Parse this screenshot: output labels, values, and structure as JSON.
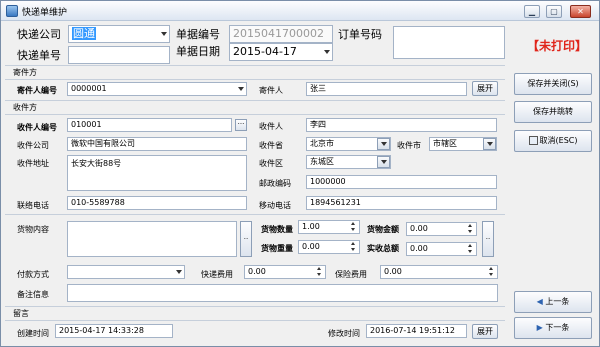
{
  "window": {
    "title": "快递单维护",
    "controls": {
      "minimize": "▁",
      "maximize": "▢",
      "close": "✕"
    }
  },
  "header": {
    "courier_company_label": "快递公司",
    "courier_company_value": "圆通",
    "doc_no_label": "单据编号",
    "doc_no_value": "2015041700002",
    "order_no_label": "订单号码",
    "order_no_value": "",
    "waybill_no_label": "快递单号",
    "waybill_no_value": "",
    "doc_date_label": "单据日期",
    "doc_date_value": "2015-04-17",
    "print_status": "【未打印】"
  },
  "sender": {
    "section_label": "寄件方",
    "sender_no_label": "寄件人编号",
    "sender_no_value": "0000001",
    "sender_label": "寄件人",
    "sender_value": "张三",
    "expand_label": "展开"
  },
  "receiver": {
    "section_label": "收件方",
    "receiver_no_label": "收件人编号",
    "receiver_no_value": "010001",
    "receiver_label": "收件人",
    "receiver_value": "李四",
    "company_label": "收件公司",
    "company_value": "微软中国有限公司",
    "province_label": "收件省",
    "province_value": "北京市",
    "city_label": "收件市",
    "city_value": "市辖区",
    "address_label": "收件地址",
    "address_value": "长安大街88号",
    "district_label": "收件区",
    "district_value": "东城区",
    "postcode_label": "邮政编码",
    "postcode_value": "1000000",
    "phone_label": "联络电话",
    "phone_value": "010-5589788",
    "mobile_label": "移动电话",
    "mobile_value": "1894561231"
  },
  "goods": {
    "content_label": "货物内容",
    "content_value": "",
    "qty_label": "货物数量",
    "qty_value": "1.00",
    "amount_label": "货物金额",
    "amount_value": "0.00",
    "weight_label": "货物重量",
    "weight_value": "0.00",
    "actual_total_label": "实收总额",
    "actual_total_value": "0.00",
    "payment_label": "付款方式",
    "payment_value": "",
    "fee_label": "快递费用",
    "fee_value": "0.00",
    "insurance_label": "保险费用",
    "insurance_value": "0.00",
    "remark_label": "备注信息",
    "remark_value": ""
  },
  "message": {
    "section_label": "留言",
    "created_label": "创建时间",
    "created_value": "2015-04-17 14:33:28",
    "modified_label": "修改时间",
    "modified_value": "2016-07-14 19:51:12",
    "expand_label": "展开"
  },
  "sidebar": {
    "save_close": "保存并关闭(S)",
    "save_jump": "保存并跳转",
    "cancel": "取消(ESC)",
    "prev": "上一条",
    "next": "下一条"
  },
  "colors": {
    "accent_red": "#e0251b",
    "selection_blue": "#3399ff",
    "border": "#a4b3c7"
  }
}
